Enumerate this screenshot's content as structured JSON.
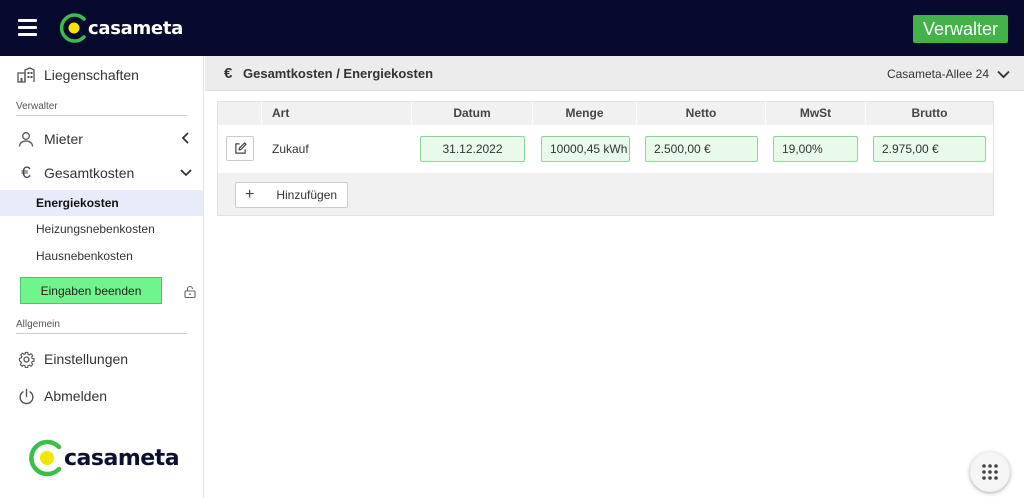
{
  "brand": {
    "name": "casameta"
  },
  "topbar": {
    "role_button": "Verwalter"
  },
  "sidebar": {
    "items": [
      {
        "label": "Liegenschaften",
        "icon": "building-icon"
      },
      {
        "label": "Mieter",
        "icon": "person-icon"
      },
      {
        "label": "Gesamtkosten",
        "icon": "euro-icon"
      },
      {
        "label": "Einstellungen",
        "icon": "gear-icon"
      },
      {
        "label": "Abmelden",
        "icon": "power-icon"
      }
    ],
    "sections": {
      "verwalter": "Verwalter",
      "allgemein": "Allgemein"
    },
    "subitems": [
      "Energiekosten",
      "Heizungsnebenkosten",
      "Hausnebenkosten"
    ],
    "active_subitem": "Energiekosten",
    "finish_button": "Eingaben beenden"
  },
  "main": {
    "title": "Gesamtkosten / Energiekosten",
    "property": "Casameta-Allee 24",
    "table": {
      "headers": [
        "Art",
        "Datum",
        "Menge",
        "Netto",
        "MwSt",
        "Brutto"
      ],
      "rows": [
        {
          "art": "Zukauf",
          "datum": "31.12.2022",
          "menge": "10000,45 kWh",
          "netto": "2.500,00 €",
          "mwst": "19,00%",
          "brutto": "2.975,00 €"
        }
      ]
    },
    "add_button": "Hinzufügen"
  },
  "colors": {
    "topbar": "#050a2e",
    "accent_green": "#43b349",
    "logo_yellow": "#f2e600",
    "input_bg": "#e8fbea"
  }
}
